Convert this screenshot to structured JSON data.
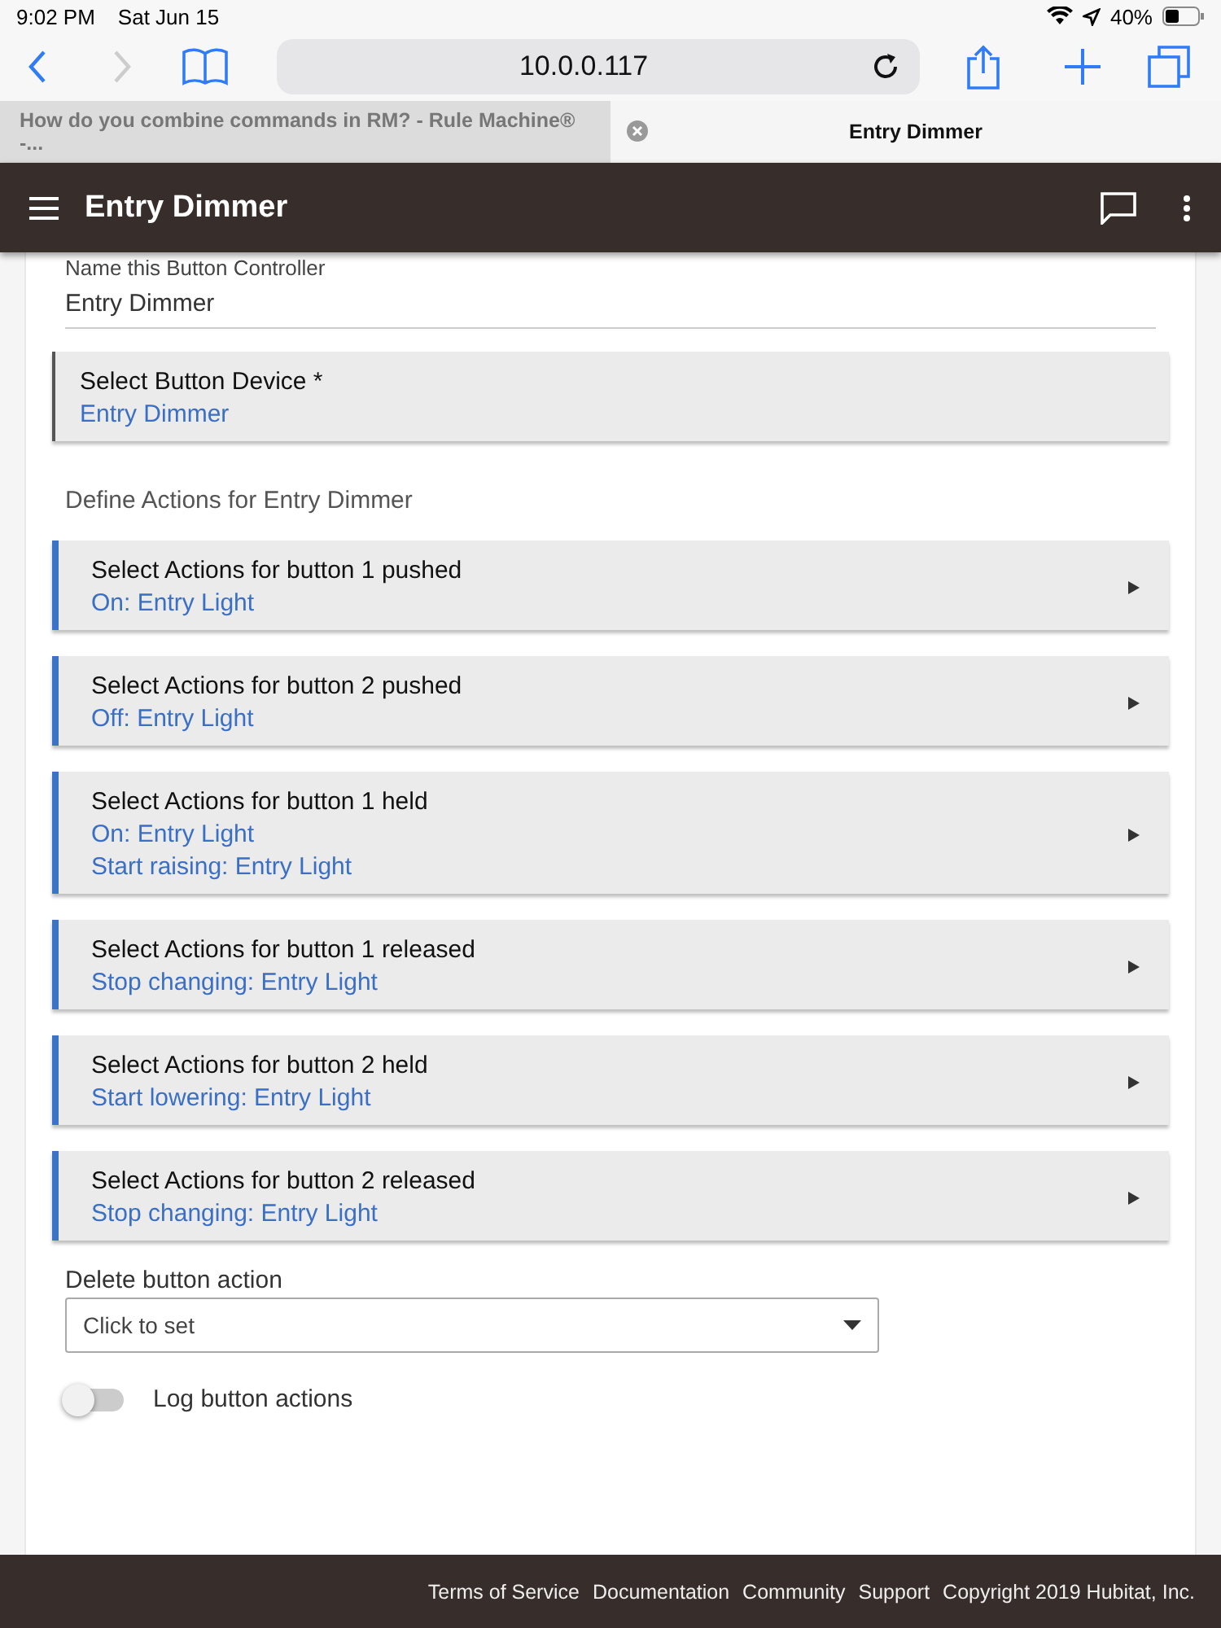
{
  "status_bar": {
    "time": "9:02 PM",
    "date": "Sat Jun 15",
    "battery": "40%"
  },
  "browser": {
    "url": "10.0.0.117",
    "tabs": [
      {
        "label": "How do you combine commands in RM? - Rule Machine® -...",
        "selected": false
      },
      {
        "label": "Entry Dimmer",
        "selected": true
      }
    ]
  },
  "header": {
    "title": "Entry Dimmer"
  },
  "name_field": {
    "label": "Name this Button Controller",
    "value": "Entry Dimmer"
  },
  "cards": [
    {
      "kind": "device",
      "title": "Select Button Device *",
      "lines": [
        "Entry Dimmer"
      ]
    },
    {
      "kind": "heading",
      "title": "Define Actions for Entry Dimmer"
    },
    {
      "kind": "action",
      "title": "Select Actions for button 1 pushed",
      "lines": [
        "On: Entry Light"
      ]
    },
    {
      "kind": "action",
      "title": "Select Actions for button 2 pushed",
      "lines": [
        "Off: Entry Light"
      ]
    },
    {
      "kind": "action",
      "title": "Select Actions for button 1 held",
      "lines": [
        "On: Entry Light",
        "Start raising: Entry Light"
      ]
    },
    {
      "kind": "action",
      "title": "Select Actions for button 1 released",
      "lines": [
        "Stop changing: Entry Light"
      ]
    },
    {
      "kind": "action",
      "title": "Select Actions for button 2 held",
      "lines": [
        "Start lowering: Entry Light"
      ]
    },
    {
      "kind": "action",
      "title": "Select Actions for button 2 released",
      "lines": [
        "Stop changing: Entry Light"
      ]
    }
  ],
  "delete_action": {
    "label": "Delete button action",
    "placeholder": "Click to set"
  },
  "log_toggle": {
    "label": "Log button actions",
    "on": false
  },
  "footer": {
    "links": [
      "Terms of Service",
      "Documentation",
      "Community",
      "Support"
    ],
    "copyright": "Copyright 2019 Hubitat, Inc."
  }
}
